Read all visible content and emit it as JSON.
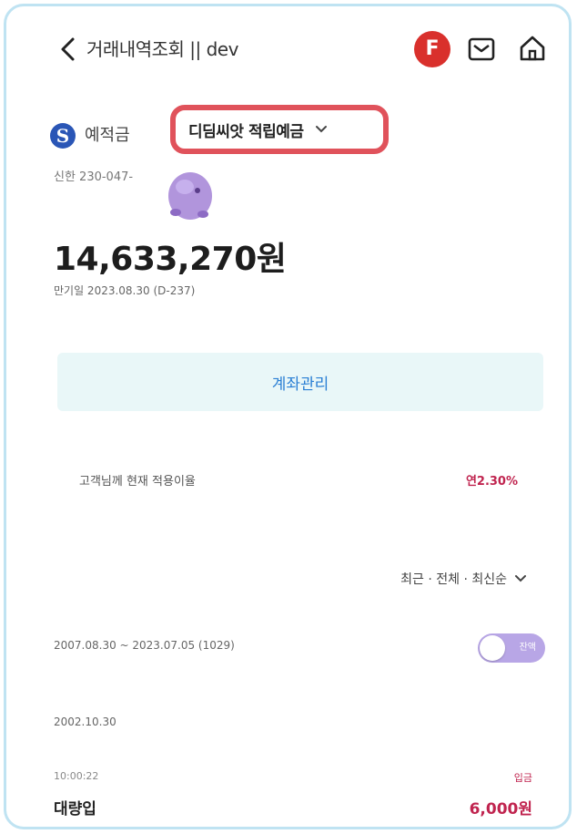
{
  "header": {
    "title": "거래내역조회 || dev",
    "profile_badge": "F",
    "icons": [
      "back-icon",
      "mail-icon",
      "home-icon"
    ]
  },
  "account": {
    "type_label": "예적금",
    "product_name": "디딤씨앗 적립예금",
    "account_number": "신한 230-047-",
    "balance": "14,633,270원",
    "maturity": "만기일 2023.08.30 (D-237)"
  },
  "actions": {
    "manage_label": "계좌관리"
  },
  "rate": {
    "label": "고객님께 현재 적용이율",
    "value": "연2.30%"
  },
  "filter": {
    "label": "최근 · 전체 · 최신순"
  },
  "period": {
    "text": "2007.08.30 ~ 2023.07.05 (1029)",
    "toggle_text": "잔액"
  },
  "transactions": {
    "date": "2002.10.30",
    "items": [
      {
        "time": "10:00:22",
        "type": "입금",
        "desc": "대량입",
        "amount": "6,000원"
      }
    ]
  },
  "colors": {
    "brand_red": "#d9302c",
    "highlight_border": "#e0525b",
    "accent_pink": "#c0244f",
    "button_bg": "#e9f7f8",
    "button_text": "#2a7fd4",
    "toggle_bg": "#b8a6e6"
  }
}
